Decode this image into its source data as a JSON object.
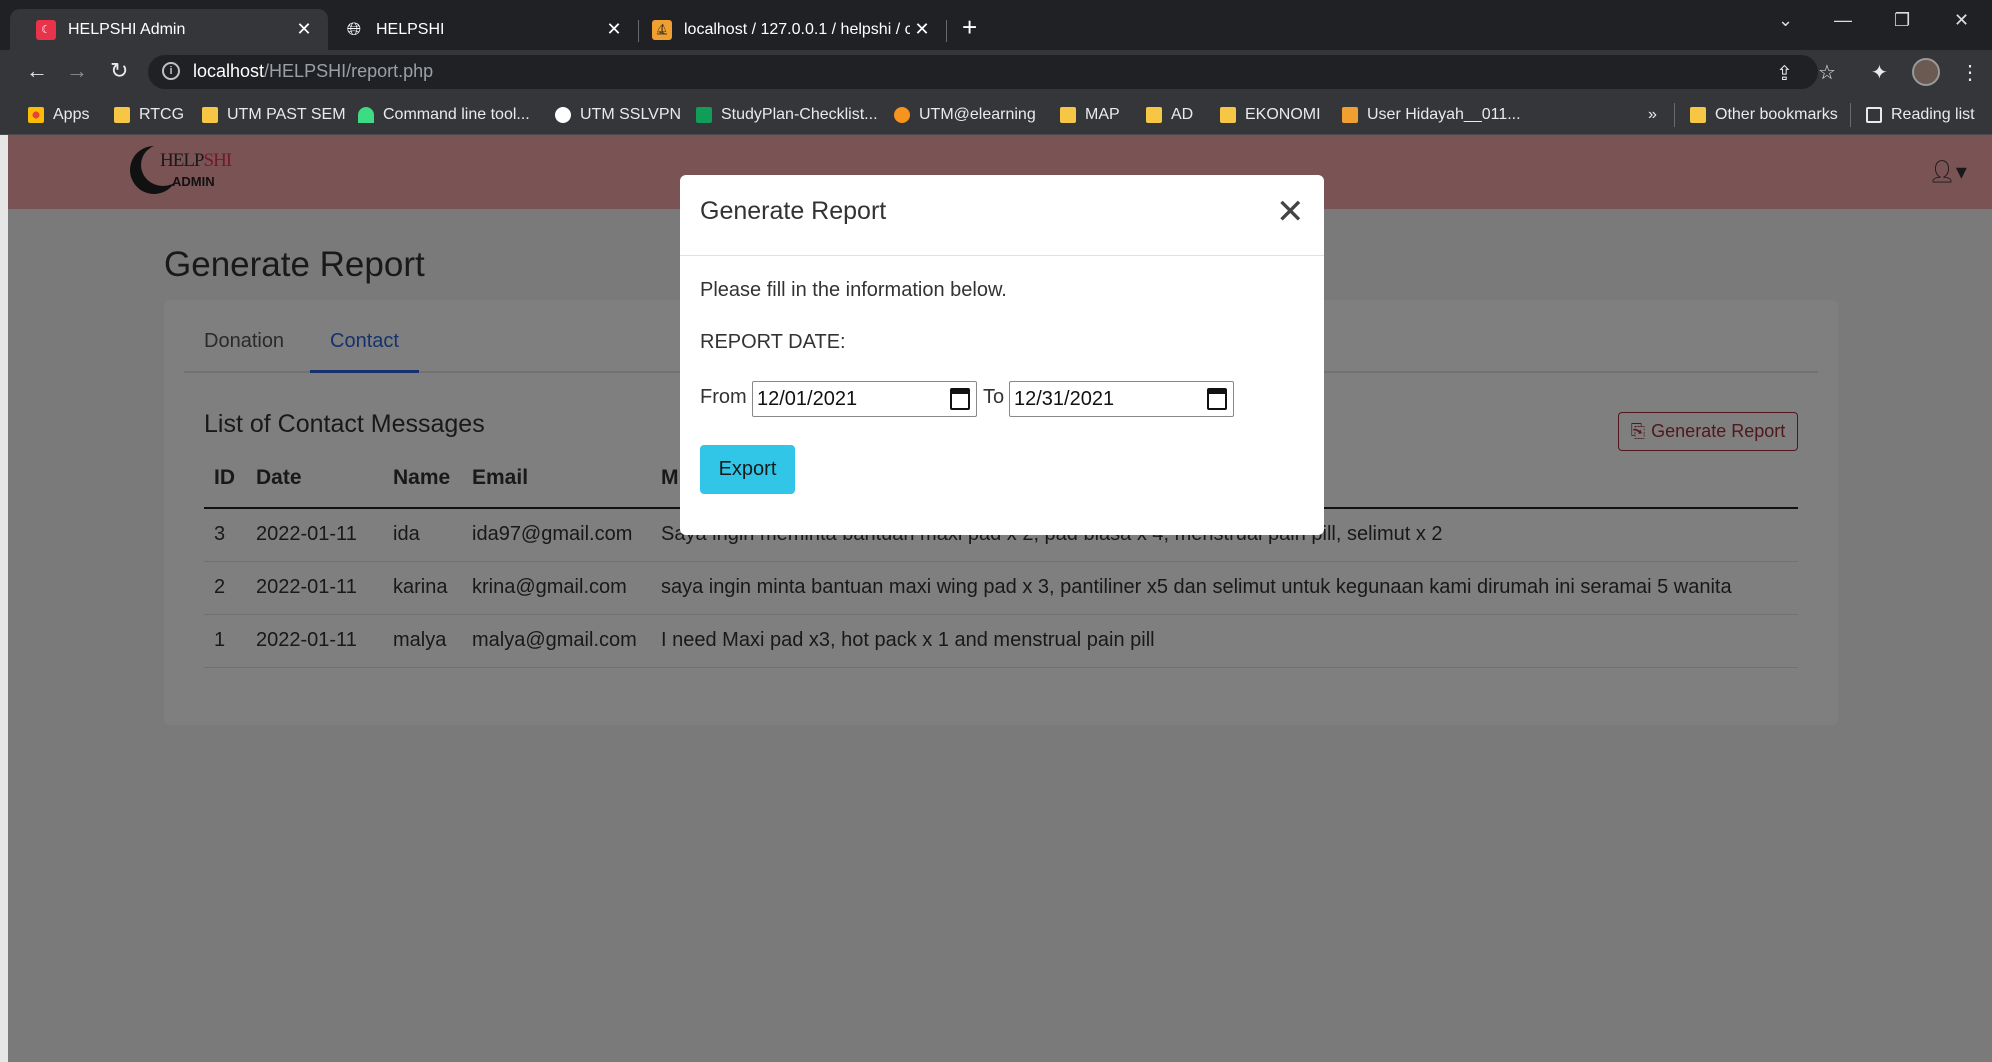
{
  "browser": {
    "tabs": [
      {
        "title": "HELPSHI Admin",
        "active": true
      },
      {
        "title": "HELPSHI",
        "active": false
      },
      {
        "title": "localhost / 127.0.0.1 / helpshi / c",
        "active": false
      }
    ],
    "url_host": "localhost",
    "url_path": "/HELPSHI/report.php",
    "bookmarks": [
      {
        "label": "Apps"
      },
      {
        "label": "RTCG"
      },
      {
        "label": "UTM PAST SEM"
      },
      {
        "label": "Command line tool..."
      },
      {
        "label": "UTM SSLVPN"
      },
      {
        "label": "StudyPlan-Checklist..."
      },
      {
        "label": "UTM@elearning"
      },
      {
        "label": "MAP"
      },
      {
        "label": "AD"
      },
      {
        "label": "EKONOMI"
      },
      {
        "label": "User Hidayah__011..."
      },
      {
        "label": "»"
      },
      {
        "label": "Other bookmarks"
      },
      {
        "label": "Reading list"
      }
    ]
  },
  "app": {
    "logo_text_1": "HELP",
    "logo_text_2": "SHI",
    "logo_sub": "ADMIN",
    "page_title": "Generate Report",
    "tabs": [
      {
        "label": "Donation",
        "active": false
      },
      {
        "label": "Contact",
        "active": true
      }
    ],
    "list_title": "List of Contact Messages",
    "generate_button": "Generate Report",
    "table": {
      "headers": [
        "ID",
        "Date",
        "Name",
        "Email",
        "M"
      ],
      "rows": [
        {
          "id": "3",
          "date": "2022-01-11",
          "name": "ida",
          "email": "ida97@gmail.com",
          "message": "Saya ingin meminta bantuan maxi pad x 2, pad biasa x 4, menstrual pain pill, selimut x 2"
        },
        {
          "id": "2",
          "date": "2022-01-11",
          "name": "karina",
          "email": "krina@gmail.com",
          "message": "saya ingin minta bantuan maxi wing pad x 3, pantiliner x5 dan selimut untuk kegunaan kami dirumah ini seramai 5 wanita"
        },
        {
          "id": "1",
          "date": "2022-01-11",
          "name": "malya",
          "email": "malya@gmail.com",
          "message": "I need Maxi pad x3, hot pack x 1 and menstrual pain pill"
        }
      ]
    }
  },
  "modal": {
    "title": "Generate Report",
    "text": "Please fill in the information below.",
    "date_label": "REPORT DATE:",
    "from_label": "From",
    "from_value": "12/01/2021",
    "to_label": "To",
    "to_value": "12/31/2021",
    "export_label": "Export"
  },
  "colors": {
    "navbar": "#f5a7a8",
    "accent_link": "#2c64d8",
    "export_button": "#31c6e8",
    "generate_button": "#a0303a"
  }
}
